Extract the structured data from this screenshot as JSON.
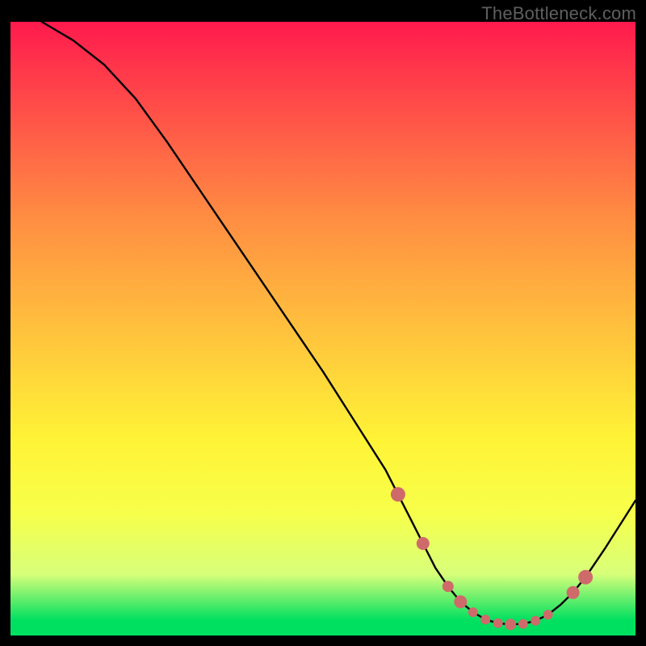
{
  "watermark": "TheBottleneck.com",
  "chart_data": {
    "type": "line",
    "title": "",
    "xlabel": "",
    "ylabel": "",
    "xlim": [
      0,
      100
    ],
    "ylim": [
      0,
      100
    ],
    "series": [
      {
        "name": "curve",
        "x": [
          5,
          10,
          15,
          20,
          25,
          30,
          35,
          40,
          45,
          50,
          55,
          60,
          62,
          64,
          66,
          68,
          70,
          72,
          74,
          76,
          78,
          80,
          82,
          84,
          86,
          88,
          90,
          92,
          95,
          100
        ],
        "y": [
          100,
          97,
          93,
          87.5,
          80.5,
          73,
          65.5,
          58,
          50.5,
          43,
          35,
          27,
          23,
          19,
          15,
          11,
          8,
          5.5,
          3.8,
          2.6,
          2.0,
          1.8,
          1.9,
          2.4,
          3.4,
          5.0,
          7.0,
          9.5,
          14,
          22
        ]
      }
    ],
    "markers": {
      "name": "highlight-points",
      "color": "#cf6a6a",
      "x": [
        62,
        66,
        70,
        72,
        74,
        76,
        78,
        80,
        82,
        84,
        86,
        90,
        92
      ],
      "y": [
        23,
        15,
        8,
        5.5,
        3.8,
        2.6,
        2.0,
        1.8,
        1.9,
        2.4,
        3.4,
        7.0,
        9.5
      ],
      "r": [
        9,
        8,
        7,
        8,
        6,
        6,
        6,
        7,
        6,
        6,
        6,
        8,
        9
      ]
    }
  }
}
